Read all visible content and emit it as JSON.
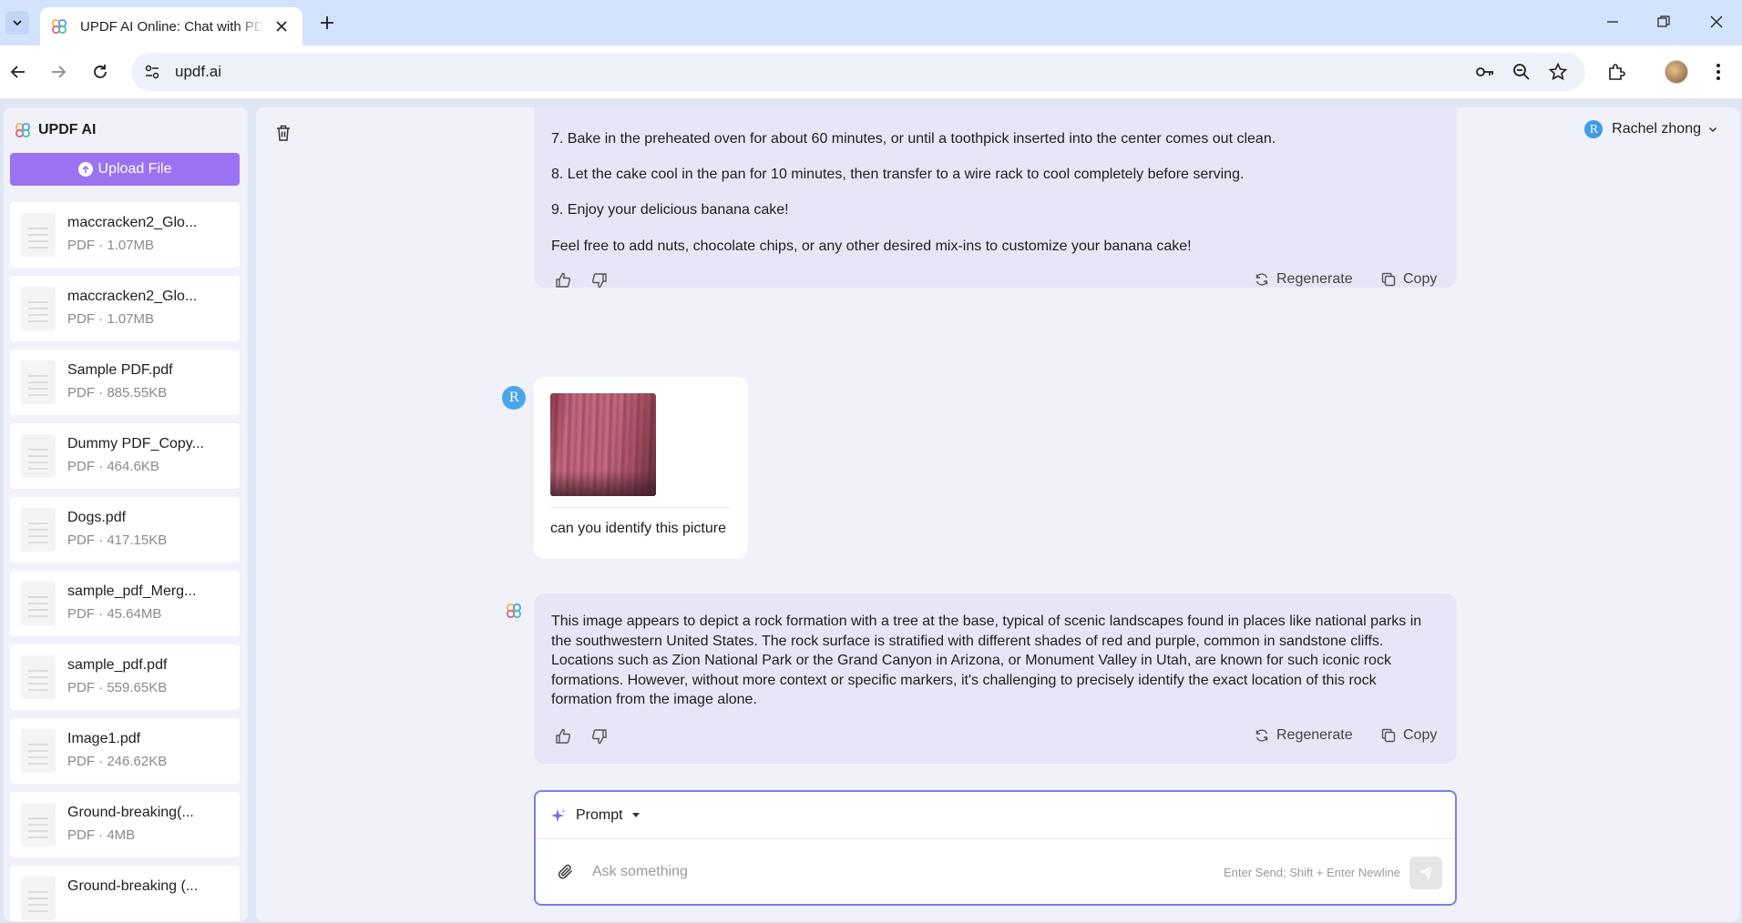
{
  "browser": {
    "tab_title": "UPDF AI Online: Chat with PDF",
    "url": "updf.ai"
  },
  "sidebar": {
    "brand": "UPDF AI",
    "upload_label": "Upload File",
    "files": [
      {
        "name": "maccracken2_Glo...",
        "meta": "PDF · 1.07MB"
      },
      {
        "name": "maccracken2_Glo...",
        "meta": "PDF · 1.07MB"
      },
      {
        "name": "Sample PDF.pdf",
        "meta": "PDF · 885.55KB"
      },
      {
        "name": "Dummy PDF_Copy...",
        "meta": "PDF · 464.6KB"
      },
      {
        "name": "Dogs.pdf",
        "meta": "PDF · 417.15KB"
      },
      {
        "name": "sample_pdf_Merg...",
        "meta": "PDF · 45.64MB"
      },
      {
        "name": "sample_pdf.pdf",
        "meta": "PDF · 559.65KB"
      },
      {
        "name": "Image1.pdf",
        "meta": "PDF · 246.62KB"
      },
      {
        "name": "Ground-breaking(...",
        "meta": "PDF · 4MB"
      },
      {
        "name": "Ground-breaking (...",
        "meta": ""
      }
    ]
  },
  "header": {
    "user_initial": "R",
    "user_name": "Rachel zhong"
  },
  "chat": {
    "ai_message_1": {
      "steps": [
        "7.  Bake in the preheated oven for about 60 minutes, or until a toothpick inserted into the center comes out clean.",
        "8.  Let the cake cool in the pan for 10 minutes, then transfer to a wire rack to cool completely before serving.",
        "9.  Enjoy your delicious banana cake!"
      ],
      "closing": "Feel free to add nuts, chocolate chips, or any other desired mix-ins to customize your banana cake!"
    },
    "user_message": {
      "initial": "R",
      "text": "can you identify this picture"
    },
    "ai_message_2": {
      "text": "This image appears to depict a rock formation with a tree at the base, typical of scenic landscapes found in places like national parks in the southwestern United States. The rock surface is stratified with different shades of red and purple, common in sandstone cliffs. Locations such as Zion National Park or the Grand Canyon in Arizona, or Monument Valley in Utah, are known for such iconic rock formations. However, without more context or specific markers, it's challenging to precisely identify the exact location of this rock formation from the image alone."
    },
    "regenerate_label": "Regenerate",
    "copy_label": "Copy"
  },
  "composer": {
    "prompt_label": "Prompt",
    "placeholder": "Ask something",
    "hint": "Enter Send; Shift + Enter Newline"
  },
  "colors": {
    "accent": "#9b72f2",
    "ai_bubble": "#e6e6f7",
    "composer_border": "#7b7fe8"
  }
}
